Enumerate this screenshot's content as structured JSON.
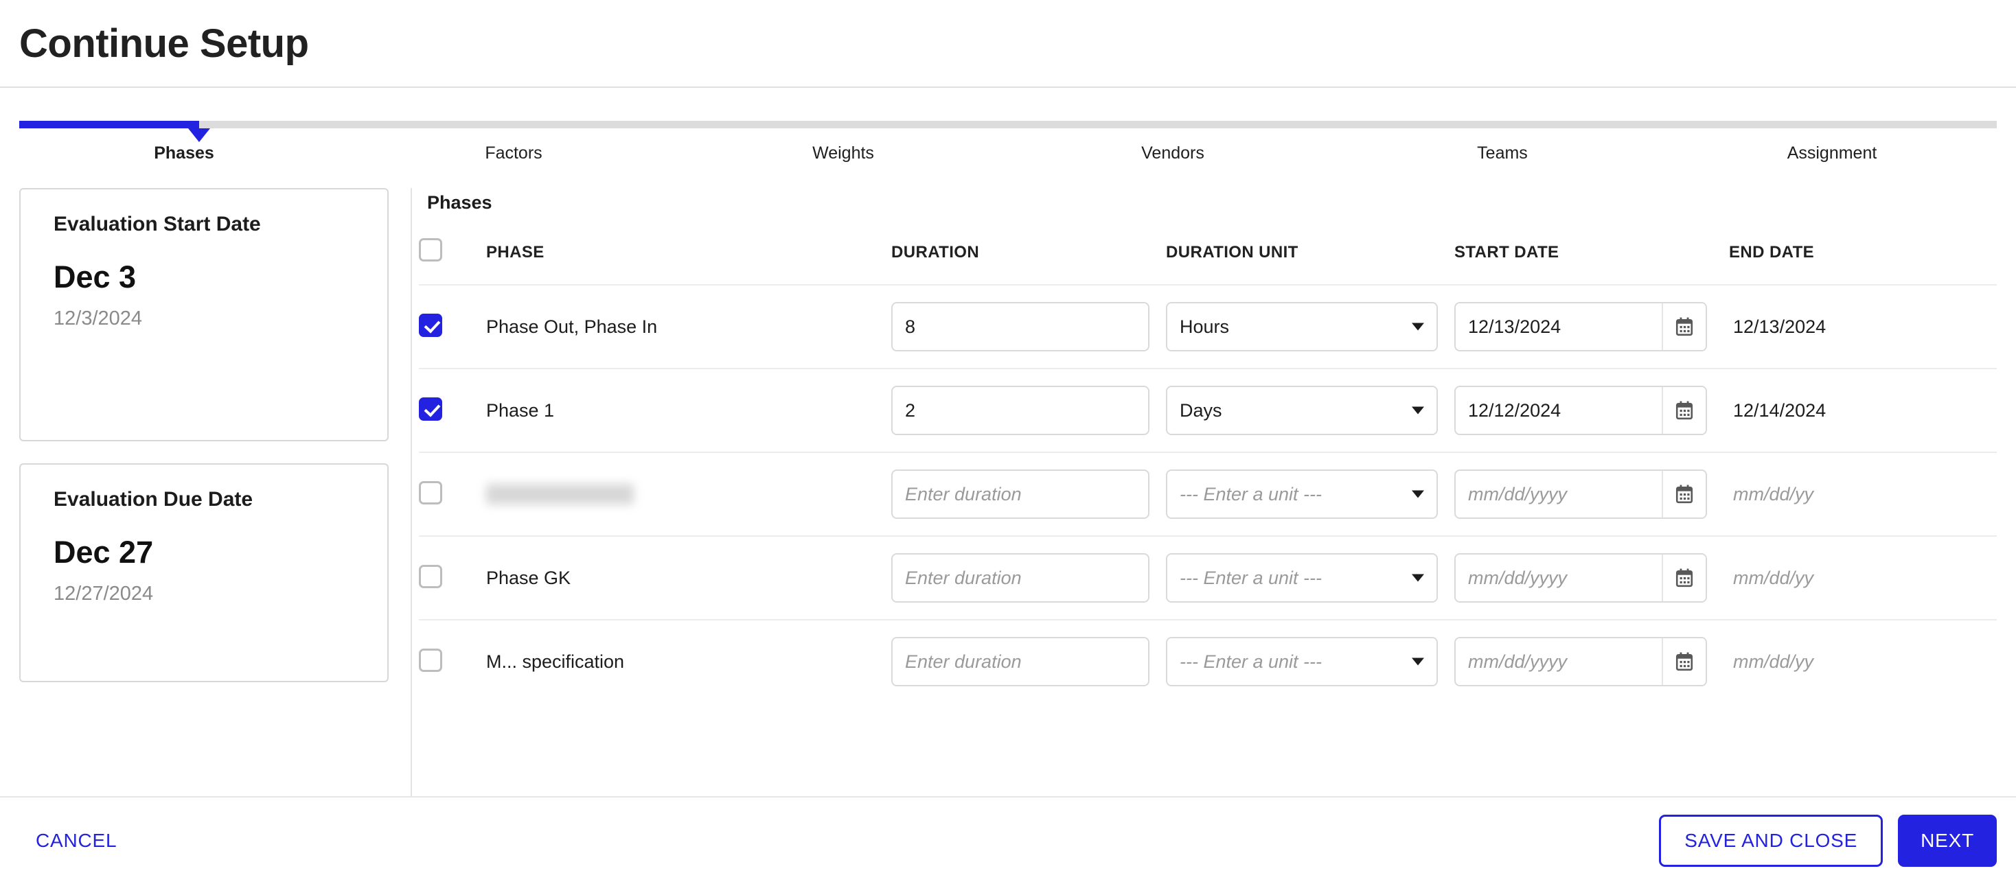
{
  "header": {
    "title": "Continue Setup"
  },
  "stepper": {
    "active_index": 0,
    "steps": [
      {
        "label": "Phases"
      },
      {
        "label": "Factors"
      },
      {
        "label": "Weights"
      },
      {
        "label": "Vendors"
      },
      {
        "label": "Teams"
      },
      {
        "label": "Assignment"
      }
    ]
  },
  "cards": [
    {
      "title": "Evaluation Start Date",
      "big": "Dec 3",
      "sub": "12/3/2024"
    },
    {
      "title": "Evaluation Due Date",
      "big": "Dec 27",
      "sub": "12/27/2024"
    }
  ],
  "table": {
    "section_title": "Phases",
    "select_all_checked": false,
    "columns": [
      {
        "key": "phase",
        "label": "PHASE"
      },
      {
        "key": "duration",
        "label": "DURATION"
      },
      {
        "key": "duration_unit",
        "label": "DURATION UNIT"
      },
      {
        "key": "start_date",
        "label": "START DATE"
      },
      {
        "key": "end_date",
        "label": "END DATE"
      }
    ],
    "placeholders": {
      "duration": "Enter duration",
      "duration_unit": "--- Enter a unit ---",
      "start_date": "mm/dd/yyyy",
      "end_date": "mm/dd/yy"
    },
    "rows": [
      {
        "checked": true,
        "phase": "Phase Out, Phase In",
        "redacted": false,
        "duration": "8",
        "duration_unit": "Hours",
        "start_date": "12/13/2024",
        "end_date": "12/13/2024"
      },
      {
        "checked": true,
        "phase": "Phase 1",
        "redacted": false,
        "duration": "2",
        "duration_unit": "Days",
        "start_date": "12/12/2024",
        "end_date": "12/14/2024"
      },
      {
        "checked": false,
        "phase": "",
        "redacted": true,
        "duration": "",
        "duration_unit": "",
        "start_date": "",
        "end_date": ""
      },
      {
        "checked": false,
        "phase": "Phase GK",
        "redacted": false,
        "duration": "",
        "duration_unit": "",
        "start_date": "",
        "end_date": ""
      },
      {
        "checked": false,
        "phase": "M... specification",
        "redacted": false,
        "duration": "",
        "duration_unit": "",
        "start_date": "",
        "end_date": ""
      }
    ]
  },
  "footer": {
    "cancel_label": "CANCEL",
    "save_and_close_label": "SAVE AND CLOSE",
    "next_label": "NEXT"
  },
  "colors": {
    "accent": "#2222e0",
    "text": "#1c1c1c",
    "muted": "#8a8a8a",
    "border": "#dadada"
  },
  "icons": {
    "calendar": "calendar-icon",
    "chevron_down": "chevron-down-icon"
  }
}
